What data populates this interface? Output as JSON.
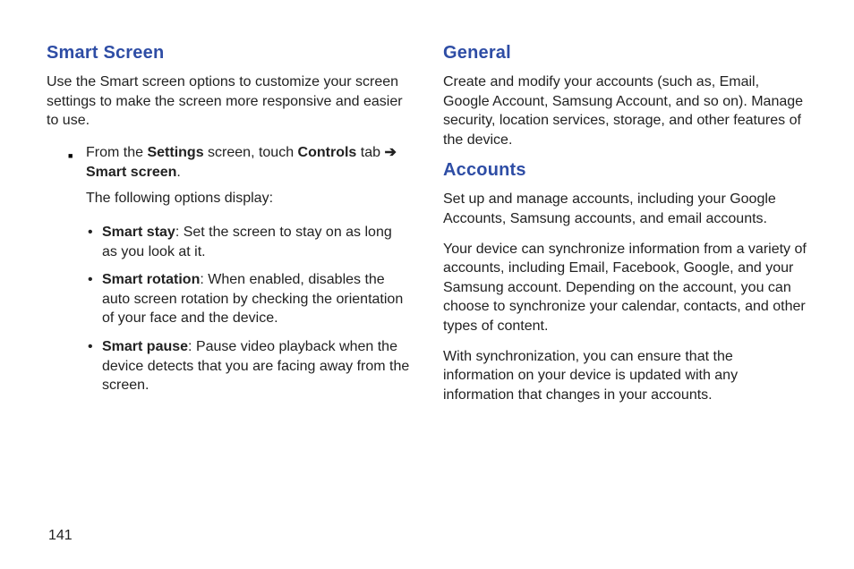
{
  "page_number": "141",
  "left": {
    "h_smart_screen": "Smart Screen",
    "smart_screen_intro": "Use the Smart screen options to customize your screen settings to make the screen more responsive and easier to use.",
    "step_prefix": "From the ",
    "step_bold1": "Settings",
    "step_mid1": " screen, touch ",
    "step_bold2": "Controls",
    "step_mid2": " tab ",
    "step_arrow": "➔",
    "step_bold3": "Smart screen",
    "step_tail": ".",
    "options_lead": "The following options display:",
    "opt1_name": "Smart stay",
    "opt1_desc": ": Set the screen to stay on as long as you look at it.",
    "opt2_name": "Smart rotation",
    "opt2_desc": ": When enabled, disables the auto screen rotation by checking the orientation of your face and the device.",
    "opt3_name": "Smart pause",
    "opt3_desc": ": Pause video playback when the device detects that you are facing away from the screen."
  },
  "right": {
    "h_general": "General",
    "general_p1": "Create and modify your accounts (such as, Email, Google Account, Samsung Account, and so on). Manage security, location services, storage, and other features of the device.",
    "h_accounts": "Accounts",
    "accounts_p1": "Set up and manage accounts, including your Google Accounts, Samsung accounts, and email accounts.",
    "accounts_p2": "Your device can synchronize information from a variety of accounts, including Email, Facebook, Google, and your Samsung account. Depending on the account, you can choose to synchronize your calendar, contacts, and other types of content.",
    "accounts_p3": "With synchronization, you can ensure that the information on your device is updated with any information that changes in your accounts."
  }
}
